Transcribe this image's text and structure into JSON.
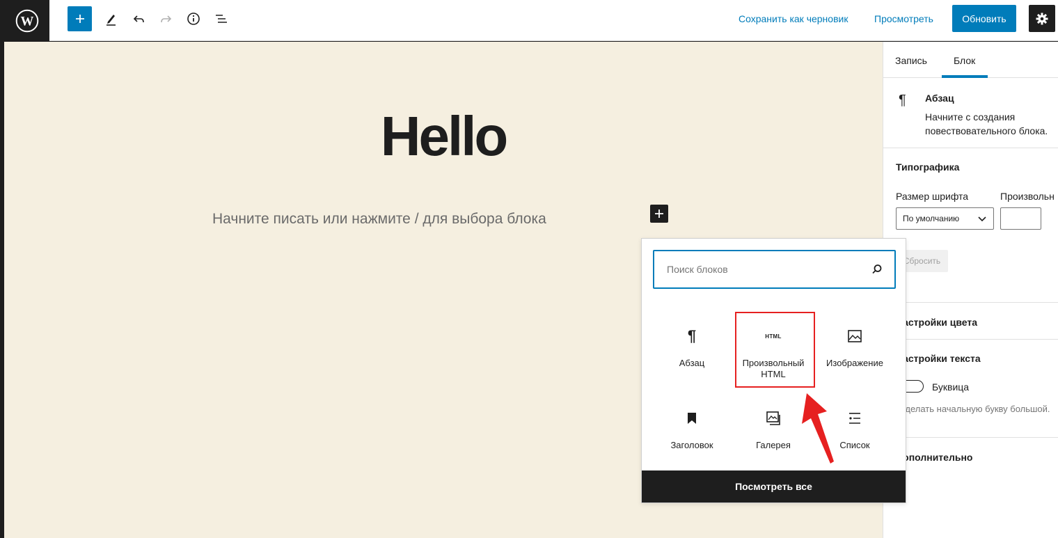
{
  "toolbar": {
    "save_draft": "Сохранить как черновик",
    "preview": "Просмотреть",
    "update": "Обновить"
  },
  "editor": {
    "title": "Hello",
    "placeholder": "Начните писать или нажмите / для выбора блока"
  },
  "sidebar": {
    "tabs": [
      {
        "label": "Запись"
      },
      {
        "label": "Блок"
      }
    ],
    "active_tab": "Блок",
    "block_card": {
      "title": "Абзац",
      "description": "Начните с создания повествовательного блока."
    },
    "typography": {
      "title": "Типографика",
      "font_size_label": "Размер шрифта",
      "custom_label": "Произвольн",
      "select_value": "По умолчанию",
      "reset_label": "Сбросить"
    },
    "color_settings": "Настройки цвета",
    "text_settings": "Настройки текста",
    "drop_cap_label": "Буквица",
    "drop_cap_help": "Сделать начальную букву большой.",
    "advanced": "Дополнительно"
  },
  "inserter": {
    "search_placeholder": "Поиск блоков",
    "blocks": [
      {
        "label": "Абзац",
        "icon": "paragraph-icon"
      },
      {
        "label": "Произвольный HTML",
        "icon": "html-icon",
        "icon_text": "HTML"
      },
      {
        "label": "Изображение",
        "icon": "image-icon"
      },
      {
        "label": "Заголовок",
        "icon": "bookmark-icon"
      },
      {
        "label": "Галерея",
        "icon": "gallery-icon"
      },
      {
        "label": "Список",
        "icon": "list-icon"
      }
    ],
    "view_all": "Посмотреть все"
  },
  "colors": {
    "accent": "#007cba",
    "highlight": "#e62020",
    "canvas": "#f5efe0",
    "dark": "#1e1e1e"
  }
}
